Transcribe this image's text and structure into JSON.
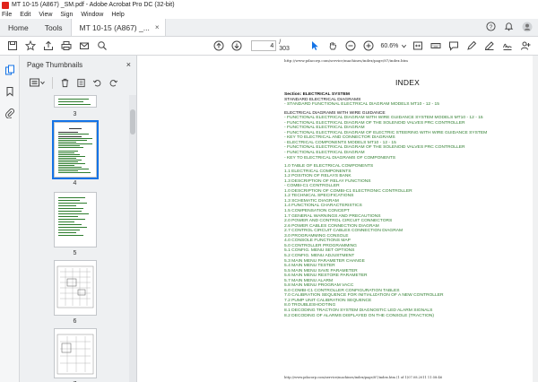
{
  "window": {
    "title": "MT 10-15 (A867) _SM.pdf - Adobe Acrobat Pro DC (32-bit)"
  },
  "menu": [
    "File",
    "Edit",
    "View",
    "Sign",
    "Window",
    "Help"
  ],
  "tabs": {
    "home": "Home",
    "tools": "Tools",
    "document": "MT 10-15 (A867) _...",
    "close": "×"
  },
  "toolbar": {
    "page_current": "4",
    "page_total": "/ 303",
    "zoom": "60.6%"
  },
  "thumbnails": {
    "title": "Page Thumbnails",
    "close": "×",
    "pages": [
      {
        "num": "3"
      },
      {
        "num": "4"
      },
      {
        "num": "5"
      },
      {
        "num": "6"
      },
      {
        "num": "7"
      }
    ]
  },
  "document": {
    "url": "http://www.pdacorp.com/service/machines/index/page/87/index.htm",
    "title": "INDEX",
    "footer": "http://www.pdacorp.com/service/machines/index/page/87/index.htm (1 of 1)07.08.2011 11:58:46",
    "lines": [
      {
        "t": "Section: ELECTRICAL SYSTEM",
        "k": "head"
      },
      {
        "t": "STANDARD ELECTRICAL DIAGRAMS",
        "k": "plain"
      },
      {
        "t": "- STANDARD FUNCTIONAL ELECTRICAL DIAGRAM MODELS MT10 - 12 - 15",
        "k": "link"
      },
      {
        "t": "",
        "k": "gap"
      },
      {
        "t": "ELECTRICAL DIAGRAMS WITH WIRE GUIDANCE",
        "k": "plain"
      },
      {
        "t": "- FUNCTIONAL ELECTRICAL DIAGRAM WITH WIRE GUIDANCE SYSTEM MODELS MT10 - 12 - 15",
        "k": "link"
      },
      {
        "t": "- FUNCTIONAL ELECTRICAL DIAGRAM OF THE SOLENOID VALVES PRC CONTROLLER",
        "k": "link"
      },
      {
        "t": "- FUNCTIONAL ELECTRICAL DIAGRAM",
        "k": "link"
      },
      {
        "t": "- FUNCTIONAL ELECTRICAL DIAGRAM OF ELECTRIC STEERING WITH WIRE GUIDANCE SYSTEM",
        "k": "link"
      },
      {
        "t": "- KEY TO ELECTRICAL AND CONNECTOR DIAGRAMS",
        "k": "link"
      },
      {
        "t": "- ELECTRICAL COMPONENTS MODELS MT10 - 12 - 15",
        "k": "link"
      },
      {
        "t": "- FUNCTIONAL ELECTRICAL DIAGRAM OF THE SOLENOID VALVES PRC CONTROLLER",
        "k": "link"
      },
      {
        "t": "- FUNCTIONAL ELECTRICAL DIAGRAM",
        "k": "link"
      },
      {
        "t": "- KEY TO ELECTRICAL DIAGRAMS OF COMPONENTS",
        "k": "link"
      },
      {
        "t": "",
        "k": "gap"
      },
      {
        "t": "1.0 TABLE OF ELECTRICAL COMPONENTS",
        "k": "link"
      },
      {
        "t": "1.1 ELECTRICAL COMPONENTS",
        "k": "link"
      },
      {
        "t": "1.2 POSITION OF RELAYS BANK",
        "k": "link"
      },
      {
        "t": "1.3 DESCRIPTION OF RELAY FUNCTIONS",
        "k": "link"
      },
      {
        "t": "- COMBI-C1 CONTROLLER",
        "k": "link"
      },
      {
        "t": "1.0 DESCRIPTION OF COMBI-C1 ELECTRONIC CONTROLLER",
        "k": "link"
      },
      {
        "t": "1.2 TECHNICAL SPECIFICATIONS",
        "k": "link"
      },
      {
        "t": "1.3 SCHEMATIC DIAGRAM",
        "k": "link"
      },
      {
        "t": "1.4 FUNCTIONAL CHARACTERISTICS",
        "k": "link"
      },
      {
        "t": "1.5 COMPENSATION CONCEPT",
        "k": "link"
      },
      {
        "t": "1.7 GENERAL WARNINGS AND PRECAUTIONS",
        "k": "link"
      },
      {
        "t": "2.0 POWER AND CONTROL CIRCUIT CONNECTORS",
        "k": "link"
      },
      {
        "t": "2.6 POWER CABLES CONNECTION DIAGRAM",
        "k": "link"
      },
      {
        "t": "2.7 CONTROL CIRCUIT CABLES CONNECTION DIAGRAM",
        "k": "link"
      },
      {
        "t": "3.0 PROGRAMMING CONSOLE",
        "k": "link"
      },
      {
        "t": "4.0 CONSOLE FUNCTIONS MAP",
        "k": "link"
      },
      {
        "t": "5.0 CONTROLLER PROGRAMMING",
        "k": "link"
      },
      {
        "t": "5.1 CONFIG. MENU SET OPTIONS",
        "k": "link"
      },
      {
        "t": "5.2 CONFIG. MENU ADJUSTMENT",
        "k": "link"
      },
      {
        "t": "5.3 MAIN MENU PARAMETER CHANGE",
        "k": "link"
      },
      {
        "t": "5.4 MAIN MENU TESTER",
        "k": "link"
      },
      {
        "t": "5.5 MAIN MENU SAVE PARAMETER",
        "k": "link"
      },
      {
        "t": "5.6 MAIN MENU RESTORE PARAMETER",
        "k": "link"
      },
      {
        "t": "5.7 MAIN MENU ALARM",
        "k": "link"
      },
      {
        "t": "5.8 MAIN MENU PROGRAM VACC",
        "k": "link"
      },
      {
        "t": "6.0 COMBI-C1 CONTROLLER CONFIGURATION TABLES",
        "k": "link"
      },
      {
        "t": "7.0 CALIBRATION SEQUENCE FOR INITIALIZATION OF A NEW CONTROLLER",
        "k": "link"
      },
      {
        "t": "7.2 PUMP UNIT CALIBRATION SEQUENCE",
        "k": "link"
      },
      {
        "t": "8.0 TROUBLESHOOTING",
        "k": "link"
      },
      {
        "t": "8.1 DECODING TRACTION SYSTEM DIAGNOSTIC LED ALARM SIGNALS",
        "k": "link"
      },
      {
        "t": "8.2 DECODING OF ALARMS DISPLAYED ON THE CONSOLE (TRACTION)",
        "k": "link"
      }
    ]
  },
  "colors": {
    "accent": "#1473e6",
    "link_green": "#2e7d2e",
    "brand_red": "#e0231b"
  }
}
